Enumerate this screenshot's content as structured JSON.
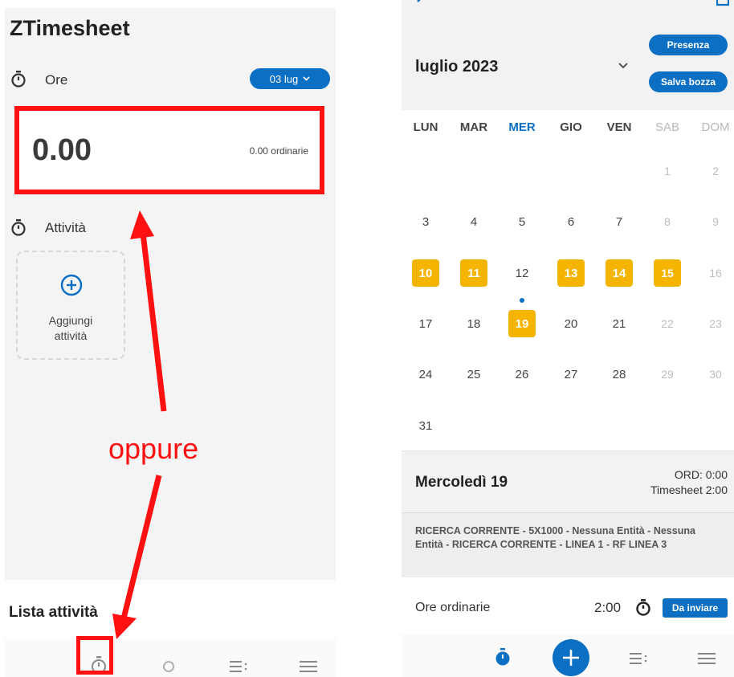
{
  "left_screen": {
    "app_title": "ZTimesheet",
    "ore_section": {
      "label": "Ore",
      "date_pill": "03 lug"
    },
    "hours_card": {
      "total": "0.00",
      "ordinary": "0.00 ordinarie"
    },
    "attivita_section": {
      "label": "Attività",
      "add_label_line1": "Aggiungi",
      "add_label_line2": "attività"
    },
    "annotation": "oppure",
    "list_title": "Lista attività",
    "nav_icons": [
      "stopwatch-icon",
      "circle-icon",
      "list-icon",
      "menu-icon"
    ]
  },
  "right_screen": {
    "month": "luglio 2023",
    "buttons": {
      "presenza": "Presenza",
      "salva_bozza": "Salva bozza"
    },
    "weekdays": [
      "LUN",
      "MAR",
      "MER",
      "GIO",
      "VEN",
      "SAB",
      "DOM"
    ],
    "today_weekday": "MER",
    "days": [
      [
        "",
        "",
        "",
        "",
        "",
        "1",
        "2"
      ],
      [
        "3",
        "4",
        "5",
        "6",
        "7",
        "8",
        "9"
      ],
      [
        "10",
        "11",
        "12",
        "13",
        "14",
        "15",
        "16"
      ],
      [
        "17",
        "18",
        "19",
        "20",
        "21",
        "22",
        "23"
      ],
      [
        "24",
        "25",
        "26",
        "27",
        "28",
        "29",
        "30"
      ],
      [
        "31",
        "",
        "",
        "",
        "",
        "",
        ""
      ]
    ],
    "highlighted_days": [
      "10",
      "11",
      "13",
      "14",
      "15",
      "19"
    ],
    "selected_day": "19",
    "detail": {
      "title": "Mercoledì 19",
      "ord": "ORD: 0:00",
      "timesheet": "Timesheet 2:00"
    },
    "project": "RICERCA CORRENTE - 5X1000 - Nessuna Entità - Nessuna Entità - RICERCA CORRENTE - LINEA 1 - RF LINEA 3",
    "ore_row": {
      "label": "Ore ordinarie",
      "value": "2:00",
      "status": "Da inviare"
    },
    "nav_icons": [
      "stopwatch-icon",
      "add-icon",
      "list-icon",
      "menu-icon"
    ]
  },
  "colors": {
    "accent": "#0b6fc4",
    "highlight": "#f5b400",
    "annotation": "#ff1111"
  }
}
